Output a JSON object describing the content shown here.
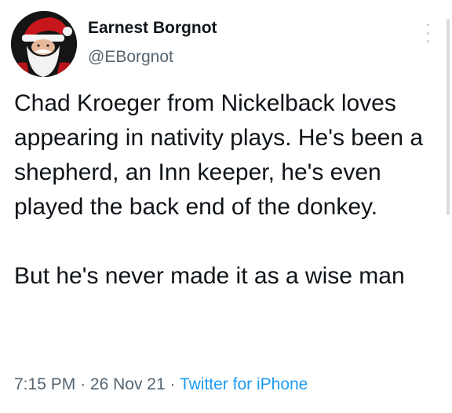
{
  "author": {
    "name": "Earnest Borgnot",
    "handle": "@EBorgnot",
    "avatar_icon": "santa-avatar-icon"
  },
  "menu_icon": "more-options-icon",
  "tweet": {
    "paragraphs": [
      "Chad Kroeger from Nickelback loves appearing in nativity plays. He's been a shepherd, an Inn keeper, he's even played the back end of the donkey.",
      "But he's never made it as a wise man"
    ]
  },
  "meta": {
    "time": "7:15 PM",
    "separator": "·",
    "date": "26 Nov 21",
    "source": "Twitter for iPhone"
  },
  "colors": {
    "text": "#0f1419",
    "secondary": "#536471",
    "link": "#1d9bf0"
  }
}
